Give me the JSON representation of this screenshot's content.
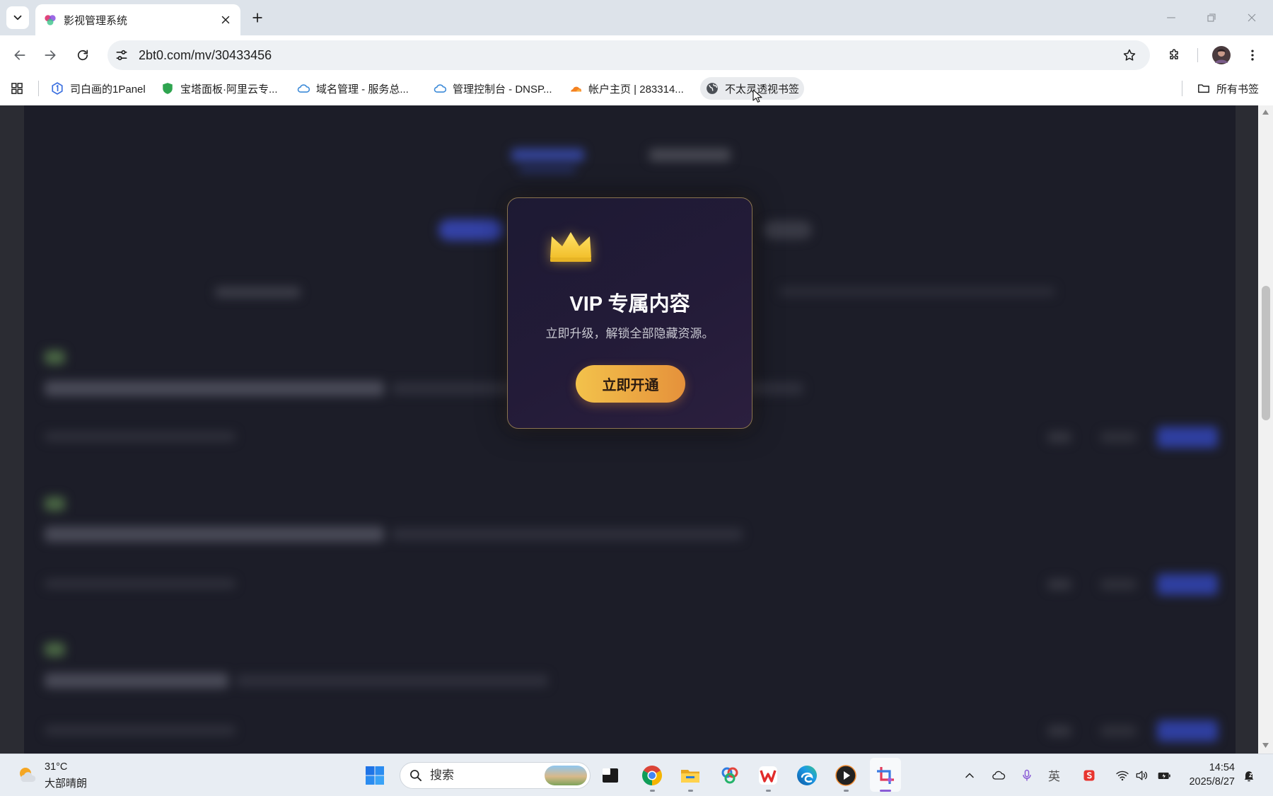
{
  "browser": {
    "tab": {
      "title": "影视管理系统"
    },
    "address": {
      "url": "2bt0.com/mv/30433456"
    },
    "bookmarks": [
      {
        "label": "司白画的1Panel",
        "icon": "1panel-icon"
      },
      {
        "label": "宝塔面板·阿里云专...",
        "icon": "shield-icon"
      },
      {
        "label": "域名管理 - 服务总...",
        "icon": "cloud-icon"
      },
      {
        "label": "管理控制台 - DNSP...",
        "icon": "cloud-icon"
      },
      {
        "label": "帐户主页 | 283314...",
        "icon": "cloudflare-icon"
      },
      {
        "label": "不太灵透视书签",
        "icon": "globe-icon"
      }
    ],
    "all_bookmarks_label": "所有书签"
  },
  "modal": {
    "icon": "crown-icon",
    "title": "VIP 专属内容",
    "subtitle": "立即升级，解锁全部隐藏资源。",
    "button_label": "立即开通"
  },
  "taskbar": {
    "weather": {
      "temp": "31°C",
      "condition": "大部晴朗"
    },
    "search_placeholder": "搜索",
    "ime": "英",
    "clock": {
      "time": "14:54",
      "date": "2025/8/27"
    }
  },
  "colors": {
    "accent_gold": "#f5c542",
    "button_gradient_start": "#f3c24b",
    "button_gradient_end": "#e5913b",
    "page_bg": "#1c1d27",
    "modal_border": "#8a7450"
  }
}
